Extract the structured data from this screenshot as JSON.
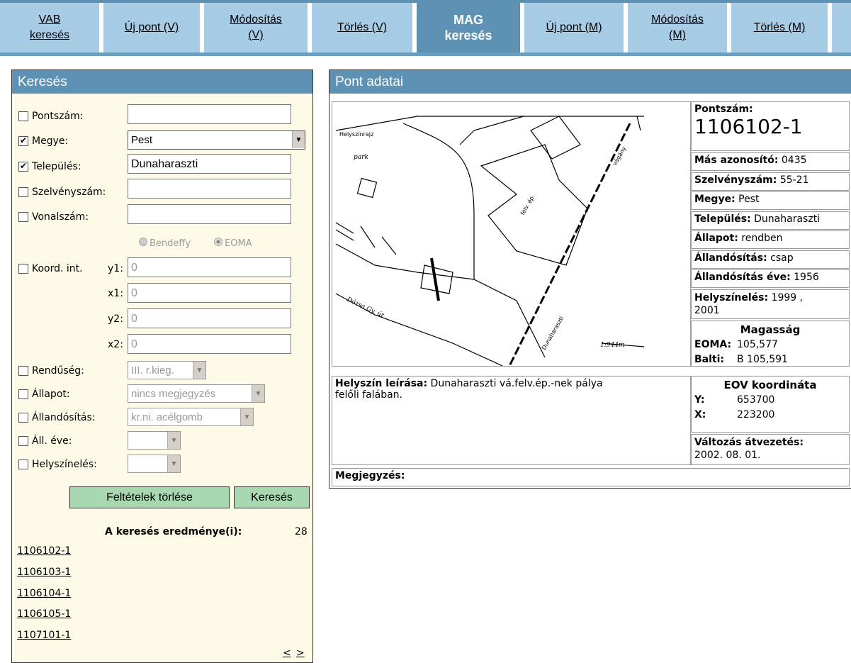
{
  "nav": [
    {
      "label_1": "VAB",
      "label_2": "keresés"
    },
    {
      "label": "Új pont (V)"
    },
    {
      "label_1": "Módosítás",
      "label_2": "(V)"
    },
    {
      "label": "Törlés (V)"
    },
    {
      "label_1": "MAG",
      "label_2": "keresés"
    },
    {
      "label": "Új pont (M)"
    },
    {
      "label_1": "Módosítás",
      "label_2": "(M)"
    },
    {
      "label": "Törlés (M)"
    }
  ],
  "search": {
    "title": "Keresés",
    "fields": {
      "pontszam_label": "Pontszám:",
      "megye_label": "Megye:",
      "megye_value": "Pest",
      "telepules_label": "Település:",
      "telepules_value": "Dunaharaszti",
      "szelveny_label": "Szelvényszám:",
      "vonal_label": "Vonalszám:",
      "radio_bendeffy": "Bendeffy",
      "radio_eoma": "EOMA",
      "koord_label": "Koord. int.",
      "y1_label": "y1:",
      "y1_value": "0",
      "x1_label": "x1:",
      "x1_value": "0",
      "y2_label": "y2:",
      "y2_value": "0",
      "x2_label": "x2:",
      "x2_value": "0",
      "rendu_label": "Rendűség:",
      "rendu_value": "III. r.kieg.",
      "allapot_label": "Állapot:",
      "allapot_value": "nincs megjegyzés",
      "allandositas_label": "Állandósítás:",
      "allandositas_value": "kr.ni. acélgomb",
      "allev_label": "Áll. éve:",
      "helyszineles_label": "Helyszínelés:"
    },
    "checked": {
      "megye": "✔",
      "telepules": "✔"
    },
    "btn_clear": "Feltételek törlése",
    "btn_search": "Keresés",
    "results_label": "A keresés eredménye(i):",
    "results_count": "28",
    "results": [
      "1106102-1",
      "1106103-1",
      "1106104-1",
      "1106105-1",
      "1107101-1"
    ],
    "pager_prev": "<",
    "pager_next": ">"
  },
  "detail": {
    "title": "Pont adatai",
    "pontszam_label": "Pontszám:",
    "pontszam_value": "1106102-1",
    "mas_label": "Más azonosító:",
    "mas_value": "0435",
    "szelveny_label": "Szelvényszám:",
    "szelveny_value": "55-21",
    "megye_label": "Megye:",
    "megye_value": "Pest",
    "telepules_label": "Település:",
    "telepules_value": "Dunaharaszti",
    "allapot_label": "Állapot:",
    "allapot_value": "rendben",
    "allandositas_label": "Állandósítás:",
    "allandositas_value": "csap",
    "allev_label": "Állandósítás éve:",
    "allev_value": "1956",
    "helyszin_label": "Helyszínelés:",
    "helyszin_value_1": "1999 ,",
    "helyszin_value_2": "2001",
    "magassag_title": "Magasság",
    "eoma_label": "EOMA:",
    "eoma_value": "105,577",
    "balti_label": "Balti:",
    "balti_value": "B 105,591",
    "leiras_label": "Helyszín leírása:",
    "leiras_value_1": "Dunaharaszti vá.felv.ép.-nek pálya",
    "leiras_value_2": "felőli falában.",
    "eov_title": "EOV koordináta",
    "y_label": "Y:",
    "y_value": "653700",
    "x_label": "X:",
    "x_value": "223200",
    "valtozas_label": "Változás átvezetés:",
    "valtozas_value": "2002. 08. 01.",
    "megjegyzes_label": "Megjegyzés:",
    "map_labels": {
      "helyszinrajz": "Helyszínrajz",
      "park": "park",
      "felv": "felv. ép.",
      "street": "Dózsa Gy. út",
      "scale": "1:944m",
      "rail": "Dunaharaszti",
      "rail2": "vágány"
    }
  }
}
